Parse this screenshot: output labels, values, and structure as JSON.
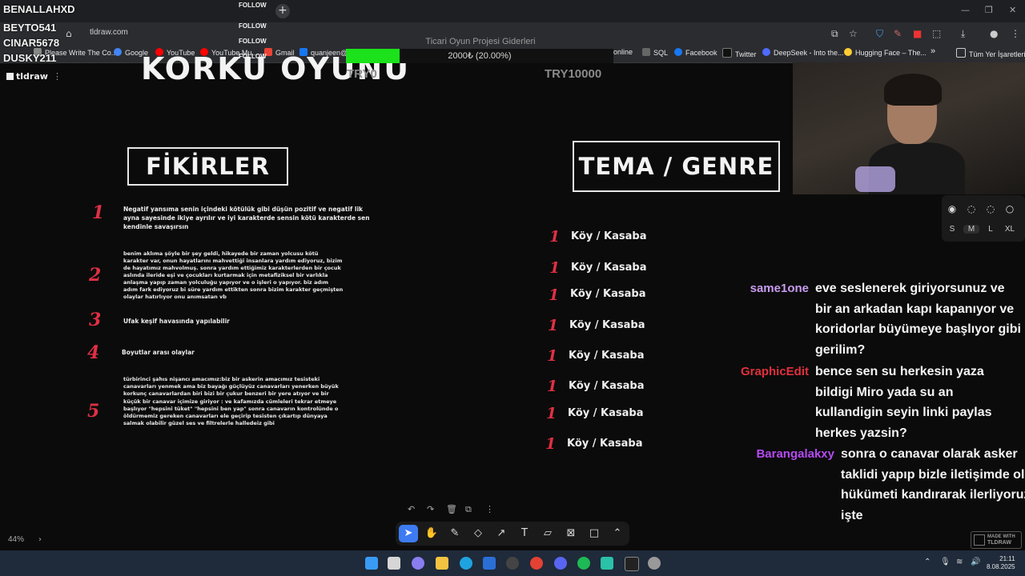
{
  "browser": {
    "url": "tldraw.com",
    "bookmarks": [
      {
        "label": "Please Write The Co...",
        "color": "#888888"
      },
      {
        "label": "Google",
        "color": "#4285f4"
      },
      {
        "label": "YouTube",
        "color": "#ff0000"
      },
      {
        "label": "YouTube Mu...",
        "color": "#ff0000"
      },
      {
        "label": "Gmail",
        "color": "#ea4335"
      },
      {
        "label": "quanjeen@y",
        "color": "#1877f2"
      },
      {
        "label": "online",
        "color": "#555555"
      },
      {
        "label": "SQL",
        "color": "#666666"
      },
      {
        "label": "Facebook",
        "color": "#1877f2"
      },
      {
        "label": "Twitter",
        "color": "#111111"
      },
      {
        "label": "DeepSeek - Into the...",
        "color": "#4d6bfe"
      },
      {
        "label": "Hugging Face – The...",
        "color": "#ffcc33"
      },
      {
        "label": "»",
        "color": ""
      },
      {
        "label": "Tüm Yer İşaretleri",
        "color": ""
      }
    ]
  },
  "stream": {
    "viewers": [
      "BENALLAHXD",
      "BEYTO541",
      "CINAR5678",
      "DUSKY211"
    ],
    "follow_label": "FOLLOW",
    "goal": {
      "title": "Ticari Oyun Projesi Giderleri",
      "progress_text": "2000₺ (20.00%)",
      "progress_fraction": 0.2,
      "min_label": "TRY0",
      "max_label": "TRY10000"
    }
  },
  "app": {
    "name": "tldraw",
    "zoom": "44%",
    "made_with": [
      "MADE WITH",
      "TLDRAW"
    ]
  },
  "canvas": {
    "big_title": "KORKU OYUNU",
    "ideas_title": "FİKİRLER",
    "genre_title": "TEMA / GENRE",
    "ideas": [
      {
        "num": "1",
        "text": "Negatif yansıma senin içindeki kötülük gibi düşün pozitif ve negatif lik ayna sayesinde ikiye ayrılır ve iyi karakterde sensin kötü karakterde sen kendinle savaşırsın"
      },
      {
        "num": "2",
        "text": "benim aklıma şöyle bir şey geldi, hikayede bir zaman yolcusu kötü karakter var, onun hayatlarını mahvettiği insanlara yardım ediyoruz, bizim de hayatımız mahvolmuş. sonra yardım ettiğimiz karakterlerden bir çocuk aslında ileride eşi ve çocukları kurtarmak için metafiziksel bir varlıkla anlaşma yapıp zaman yolculuğu yapıyor ve o işleri o yapıyor. biz adım adım fark ediyoruz bi süre yardım ettikten sonra bizim karakter geçmişten olaylar hatırlıyor onu anımsatan vb"
      },
      {
        "num": "3",
        "text": "Ufak keşif havasında yapılabilir"
      },
      {
        "num": "4",
        "text": "Boyutlar arası olaylar"
      },
      {
        "num": "5",
        "text": "türbirinci şahıs nişancı amacımız:biz bir askerin amacımız tesisteki canavarları yenmek ama biz bayağı güçlüyüz canavarları yenerken büyük korkunç canavarlardan biri bizi bir çukur benzeri bir yere atıyor ve bir küçük bir canavar içimize giriyor : ve kafamızda cümleleri tekrar etmeye başlıyor \"hepsini tüket\" \"hepsini ben yap\" sonra canavarın kontrolünde o öldürmemiz gereken canavarları ele geçirip tesisten çıkartıp dünyaya salmak olabilir güzel ses ve filtrelerle halledeiz gibi"
      }
    ],
    "genres": [
      {
        "num": "1",
        "text": "Köy / Kasaba"
      },
      {
        "num": "1",
        "text": "Köy / Kasaba"
      },
      {
        "num": "1",
        "text": "Köy / Kasaba"
      },
      {
        "num": "1",
        "text": "Köy / Kasaba"
      },
      {
        "num": "1",
        "text": "Köy / Kasaba"
      },
      {
        "num": "1",
        "text": "Köy / Kasaba"
      },
      {
        "num": "1",
        "text": "Köy / Kasaba"
      },
      {
        "num": "1",
        "text": "Köy / Kasaba"
      }
    ]
  },
  "style_panel": {
    "sizes": [
      "S",
      "M",
      "L",
      "XL"
    ],
    "selected": "M"
  },
  "chat": [
    {
      "user": "same1one",
      "color": "#c89cf0",
      "lines": [
        "eve seslenerek giriyorsunuz ve",
        "bir an arkadan kapı kapanıyor ve",
        "koridorlar büyümeye başlıyor gibi",
        "gerilim?"
      ]
    },
    {
      "user": "GraphicEdit",
      "color": "#e0303e",
      "lines": [
        "bence sen su herkesin yaza",
        "bildigi Miro yada su an",
        "kullandigin seyin linki paylas",
        "herkes yazsin?"
      ]
    },
    {
      "user": "Barangalakxy",
      "color": "#b44bf0",
      "lines": [
        "sonra o canavar olarak asker",
        "taklidi yapıp bizle iletişimde ol",
        "hükümeti kandırarak ilerliyoruz",
        "işte"
      ]
    }
  ],
  "taskbar": {
    "time": "21:11",
    "date": "8.08.2025"
  }
}
